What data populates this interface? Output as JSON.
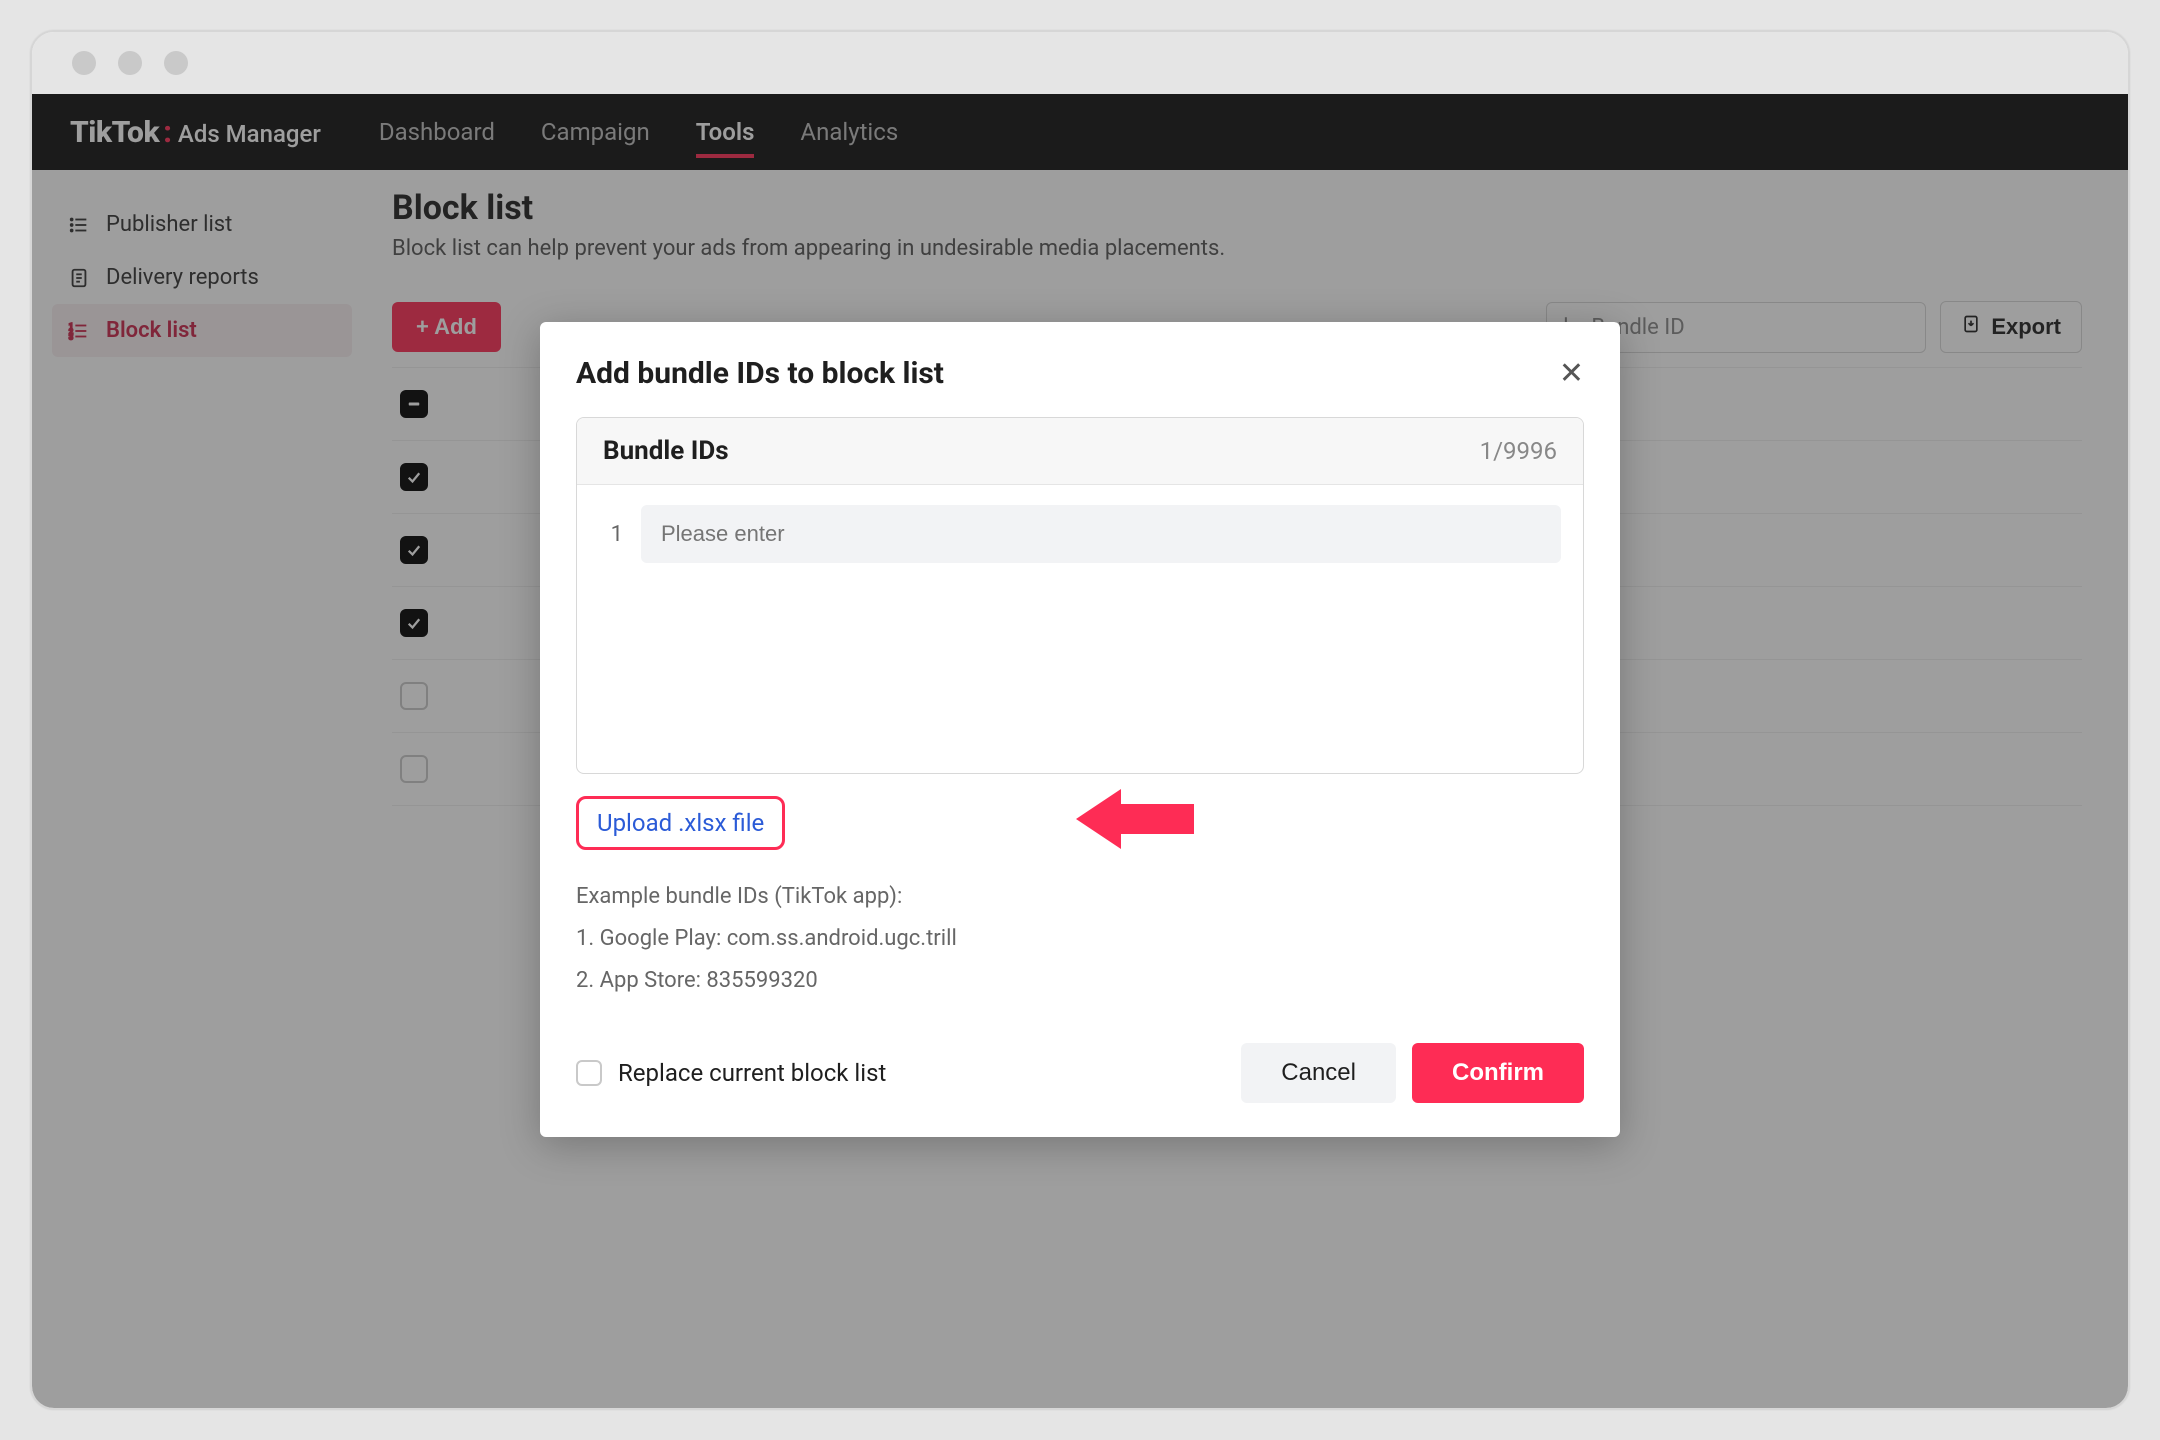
{
  "brand": {
    "main": "TikTok",
    "sub": "Ads Manager"
  },
  "nav": {
    "items": [
      {
        "label": "Dashboard"
      },
      {
        "label": "Campaign"
      },
      {
        "label": "Tools",
        "active": true
      },
      {
        "label": "Analytics"
      }
    ]
  },
  "sidebar": {
    "items": [
      {
        "label": "Publisher list",
        "icon": "list-icon"
      },
      {
        "label": "Delivery reports",
        "icon": "document-icon"
      },
      {
        "label": "Block list",
        "icon": "blocklist-icon",
        "active": true
      }
    ]
  },
  "page": {
    "title": "Block list",
    "description": "Block list can help prevent your ads from appearing in undesirable media placements."
  },
  "toolbar": {
    "add_label": "+ Add",
    "search_placeholder": "by Bundle ID",
    "export_label": "Export"
  },
  "list": {
    "rows": [
      {
        "state": "indeterminate"
      },
      {
        "state": "checked"
      },
      {
        "state": "checked"
      },
      {
        "state": "checked"
      },
      {
        "state": "empty"
      },
      {
        "state": "empty"
      }
    ]
  },
  "modal": {
    "title": "Add bundle IDs to block list",
    "panel_title": "Bundle IDs",
    "count_label": "1/9996",
    "row_number": "1",
    "input_placeholder": "Please enter",
    "upload_label": "Upload .xlsx file",
    "example_heading": "Example bundle IDs (TikTok app):",
    "example_line1": "1. Google Play: com.ss.android.ugc.trill",
    "example_line2": "2. App Store: 835599320",
    "replace_label": "Replace current block list",
    "cancel_label": "Cancel",
    "confirm_label": "Confirm"
  }
}
